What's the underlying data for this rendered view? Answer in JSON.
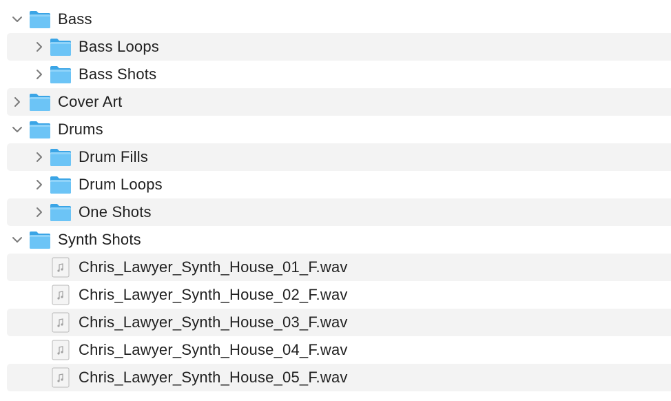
{
  "colors": {
    "folder_back": "#3ba5e6",
    "folder_front": "#6cc4f6",
    "row_alt": "#f3f3f3",
    "chevron": "#7a7a7a",
    "file_bg": "#f4f4f4",
    "file_border": "#b8b8b8"
  },
  "tree": {
    "bass": {
      "label": "Bass",
      "icon": "folder-icon",
      "expanded": true,
      "children": {
        "bass_loops": {
          "label": "Bass Loops",
          "icon": "folder-icon",
          "expanded": false
        },
        "bass_shots": {
          "label": "Bass Shots",
          "icon": "folder-icon",
          "expanded": false
        }
      }
    },
    "cover_art": {
      "label": "Cover Art",
      "icon": "folder-icon",
      "expanded": false
    },
    "drums": {
      "label": "Drums",
      "icon": "folder-icon",
      "expanded": true,
      "children": {
        "drum_fills": {
          "label": "Drum Fills",
          "icon": "folder-icon",
          "expanded": false
        },
        "drum_loops": {
          "label": "Drum Loops",
          "icon": "folder-icon",
          "expanded": false
        },
        "one_shots": {
          "label": "One Shots",
          "icon": "folder-icon",
          "expanded": false
        }
      }
    },
    "synth_shots": {
      "label": "Synth Shots",
      "icon": "folder-icon",
      "expanded": true,
      "files": [
        {
          "label": "Chris_Lawyer_Synth_House_01_F.wav",
          "icon": "audio-file-icon"
        },
        {
          "label": "Chris_Lawyer_Synth_House_02_F.wav",
          "icon": "audio-file-icon"
        },
        {
          "label": "Chris_Lawyer_Synth_House_03_F.wav",
          "icon": "audio-file-icon"
        },
        {
          "label": "Chris_Lawyer_Synth_House_04_F.wav",
          "icon": "audio-file-icon"
        },
        {
          "label": "Chris_Lawyer_Synth_House_05_F.wav",
          "icon": "audio-file-icon"
        }
      ]
    }
  }
}
